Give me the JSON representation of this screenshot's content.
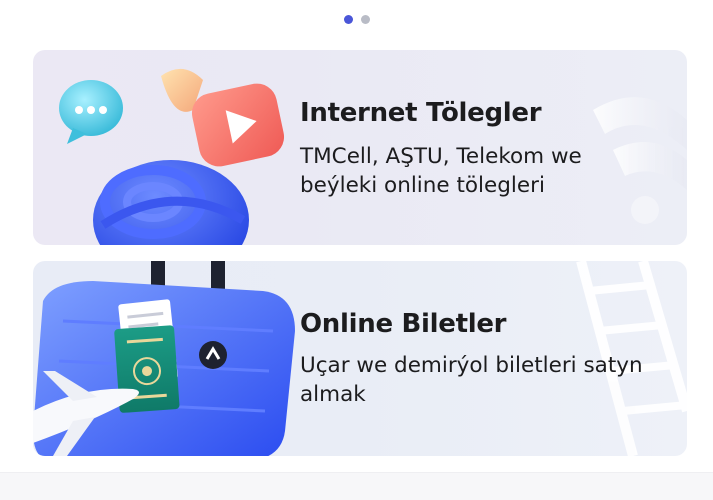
{
  "pager": {
    "count": 2,
    "active": 0,
    "active_color": "#4a56d8",
    "inactive_color": "#b9bcc6"
  },
  "cards": [
    {
      "title": "Internet Tölegler",
      "description": "TMCell, AŞTU, Telekom we beýleki online tölegleri",
      "illustration": "internet-payments-illustration"
    },
    {
      "title": "Online Biletler",
      "description": "Uçar we demirýol biletleri satyn almak",
      "illustration": "online-tickets-illustration"
    }
  ]
}
